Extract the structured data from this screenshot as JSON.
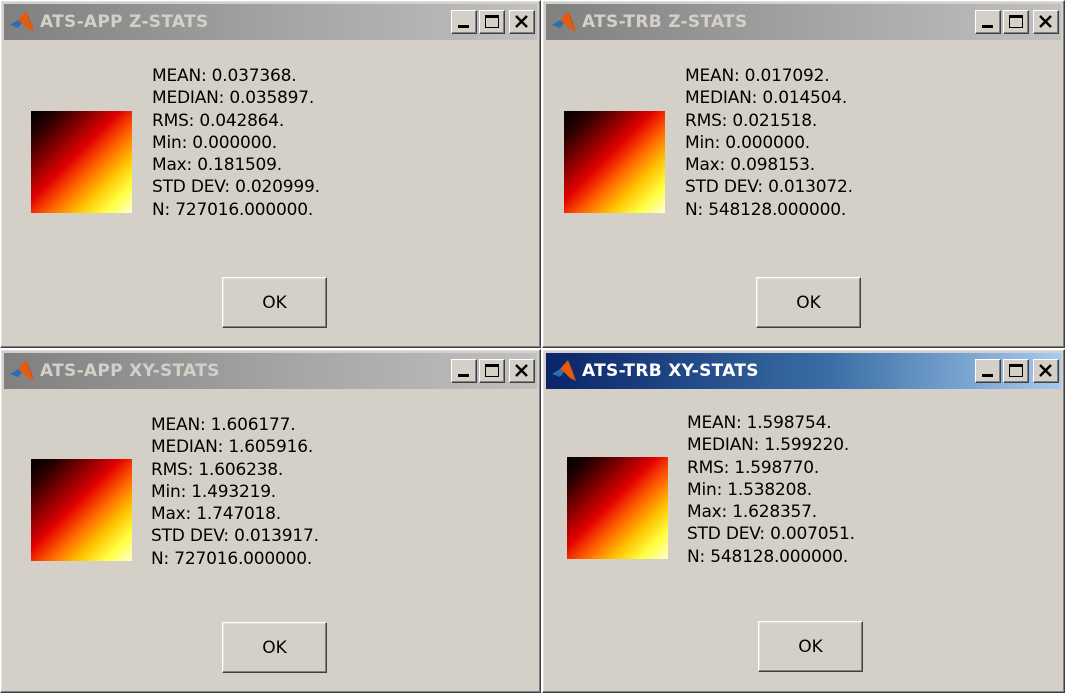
{
  "dialogs": [
    {
      "title": "ATS-APP Z-STATS",
      "active": false,
      "stats": [
        "MEAN: 0.037368.",
        "MEDIAN: 0.035897.",
        "RMS: 0.042864.",
        "Min: 0.000000.",
        "Max: 0.181509.",
        "STD DEV: 0.020999.",
        "N: 727016.000000."
      ],
      "ok_label": "OK"
    },
    {
      "title": "ATS-TRB Z-STATS",
      "active": false,
      "stats": [
        "MEAN: 0.017092.",
        "MEDIAN: 0.014504.",
        "RMS: 0.021518.",
        "Min: 0.000000.",
        "Max: 0.098153.",
        "STD DEV: 0.013072.",
        "N: 548128.000000."
      ],
      "ok_label": "OK"
    },
    {
      "title": "ATS-APP XY-STATS",
      "active": false,
      "stats": [
        "MEAN: 1.606177.",
        "MEDIAN: 1.605916.",
        "RMS: 1.606238.",
        "Min: 1.493219.",
        "Max: 1.747018.",
        "STD DEV: 0.013917.",
        "N: 727016.000000."
      ],
      "ok_label": "OK"
    },
    {
      "title": "ATS-TRB XY-STATS",
      "active": true,
      "stats": [
        "MEAN: 1.598754.",
        "MEDIAN: 1.599220.",
        "RMS: 1.598770.",
        "Min: 1.538208.",
        "Max: 1.628357.",
        "STD DEV: 0.007051.",
        "N: 548128.000000."
      ],
      "ok_label": "OK"
    }
  ],
  "icons": {
    "app": "matlab-logo-icon",
    "minimize": "minimize-icon",
    "maximize": "maximize-icon",
    "close": "close-icon",
    "colormap": "hot-colormap-swatch"
  },
  "colors": {
    "window_face": "#d4d0c8",
    "inactive_title": "#808080",
    "inactive_title_text": "#d4d0c8",
    "active_title": "#0a246a",
    "active_title_text": "#ffffff"
  }
}
